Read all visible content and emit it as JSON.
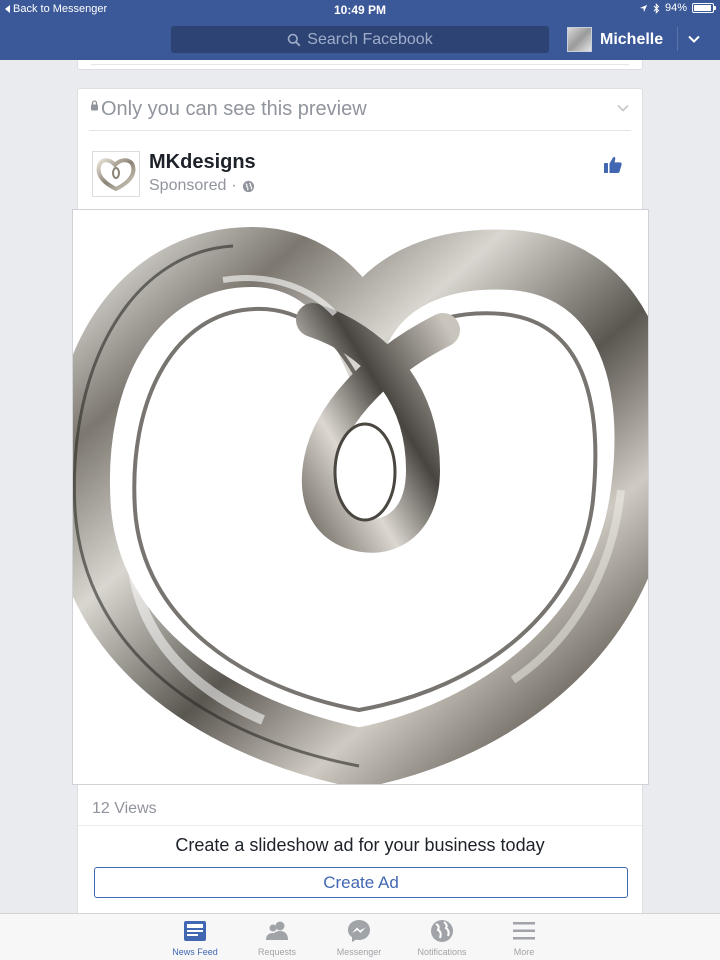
{
  "status_bar": {
    "back_label": "Back to Messenger",
    "time": "10:49 PM",
    "battery": "94%",
    "battery_level": 0.94
  },
  "header": {
    "search_placeholder": "Search Facebook",
    "user_name": "Michelle"
  },
  "post": {
    "privacy_notice": "Only you can see this preview",
    "page_name": "MKdesigns",
    "sponsored_label": "Sponsored",
    "separator": "·",
    "image_subject": "silver-heart-sculpture",
    "views": "12 Views",
    "cta_text": "Create a slideshow ad for your business today",
    "cta_button": "Create Ad"
  },
  "tabs": [
    {
      "label": "News Feed",
      "icon": "news-feed-icon",
      "active": true
    },
    {
      "label": "Requests",
      "icon": "requests-icon",
      "active": false
    },
    {
      "label": "Messenger",
      "icon": "messenger-icon",
      "active": false
    },
    {
      "label": "Notifications",
      "icon": "notifications-globe-icon",
      "active": false
    },
    {
      "label": "More",
      "icon": "more-menu-icon",
      "active": false
    }
  ],
  "colors": {
    "brand_blue": "#3b5998",
    "link_blue": "#4267b2",
    "background": "#e9ebee"
  }
}
